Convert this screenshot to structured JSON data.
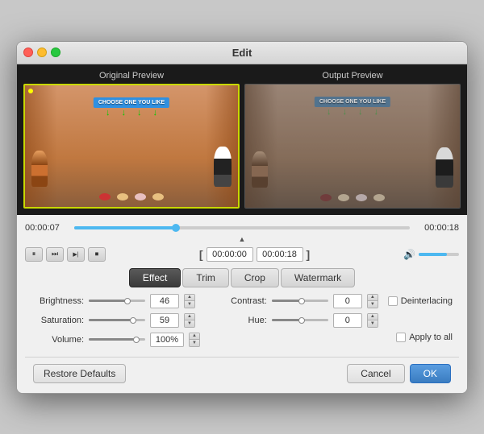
{
  "window": {
    "title": "Edit"
  },
  "previews": {
    "original_label": "Original Preview",
    "output_label": "Output Preview"
  },
  "timeline": {
    "start_time": "00:00:07",
    "end_time": "00:00:18",
    "progress_percent": 30
  },
  "time_range": {
    "start": "00:00:00",
    "end": "00:00:18"
  },
  "tabs": [
    {
      "label": "Effect",
      "active": true
    },
    {
      "label": "Trim",
      "active": false
    },
    {
      "label": "Crop",
      "active": false
    },
    {
      "label": "Watermark",
      "active": false
    }
  ],
  "effect": {
    "brightness_label": "Brightness:",
    "brightness_value": "46",
    "contrast_label": "Contrast:",
    "contrast_value": "0",
    "saturation_label": "Saturation:",
    "saturation_value": "59",
    "hue_label": "Hue:",
    "hue_value": "0",
    "volume_label": "Volume:",
    "volume_value": "100%",
    "deinterlacing_label": "Deinterlacing",
    "apply_all_label": "Apply to all"
  },
  "buttons": {
    "restore": "Restore Defaults",
    "cancel": "Cancel",
    "ok": "OK"
  },
  "banner_text": "CHOOSE ONE YOU LIKE",
  "controls": {
    "pause_icon": "⏸",
    "next_icon": "⏭",
    "stop_icon": "⏹",
    "bracket_open": "[",
    "bracket_close": "]"
  }
}
